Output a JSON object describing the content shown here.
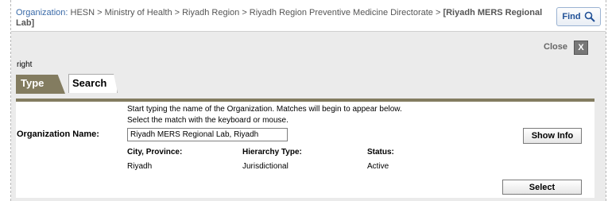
{
  "breadcrumb": {
    "label": "Organization:",
    "path": "HESN > Ministry of Health > Riyadh Region > Riyadh Region Preventive Medicine Directorate > ",
    "current": "[Riyadh MERS Regional Lab]"
  },
  "find": {
    "label": "Find",
    "icon": "search-icon"
  },
  "close": {
    "label": "Close",
    "icon_text": "X"
  },
  "stray_text": "right",
  "tabs": [
    {
      "label": "Type",
      "active": true
    },
    {
      "label": "Search",
      "active": false
    }
  ],
  "instructions": {
    "line1": "Start typing the name of the Organization. Matches will begin to appear below.",
    "line2": "Select the match with the keyboard or mouse."
  },
  "org_field": {
    "label": "Organization Name:",
    "value": "Riyadh MERS Regional Lab, Riyadh"
  },
  "show_info": {
    "label": "Show Info"
  },
  "details": {
    "city_label": "City, Province:",
    "city_value": "Riyadh",
    "hierarchy_label": "Hierarchy Type:",
    "hierarchy_value": "Jurisdictional",
    "status_label": "Status:",
    "status_value": "Active"
  },
  "select": {
    "label": "Select"
  },
  "colors": {
    "tab_accent": "#837c60",
    "link_blue": "#3a6aa8",
    "panel_bg": "#ebebeb"
  }
}
